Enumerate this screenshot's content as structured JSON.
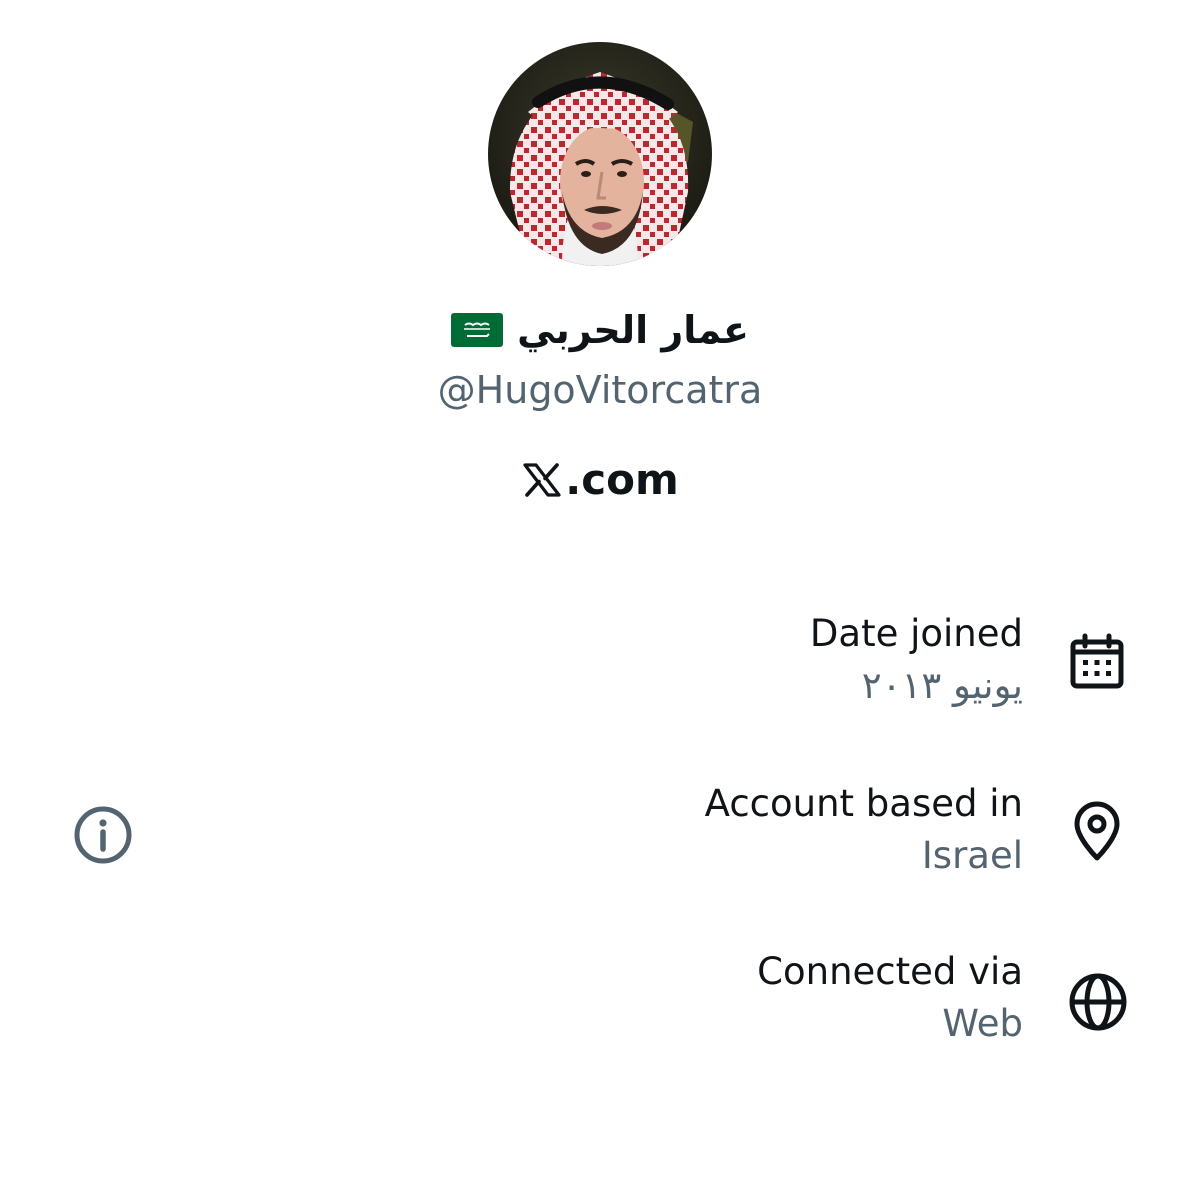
{
  "profile": {
    "display_name": "عمار الحربي",
    "handle": "@HugoVitorcatra",
    "flag_icon": "saudi-arabia-flag-icon",
    "avatar_icon": "profile-avatar"
  },
  "brand": {
    "logo_icon": "x-logo-icon",
    "text": ".com"
  },
  "about": {
    "rows": [
      {
        "label": "Date joined",
        "value": "يونيو ٢٠١٣",
        "icon": "calendar-icon"
      },
      {
        "label": "Account based in",
        "value": "Israel",
        "icon": "location-pin-icon"
      },
      {
        "label": "Connected via",
        "value": "Web",
        "icon": "globe-icon"
      }
    ],
    "info_icon": "info-icon"
  },
  "colors": {
    "text_primary": "#0f1419",
    "text_secondary": "#536471",
    "flag_green": "#006c35",
    "background": "#ffffff"
  }
}
